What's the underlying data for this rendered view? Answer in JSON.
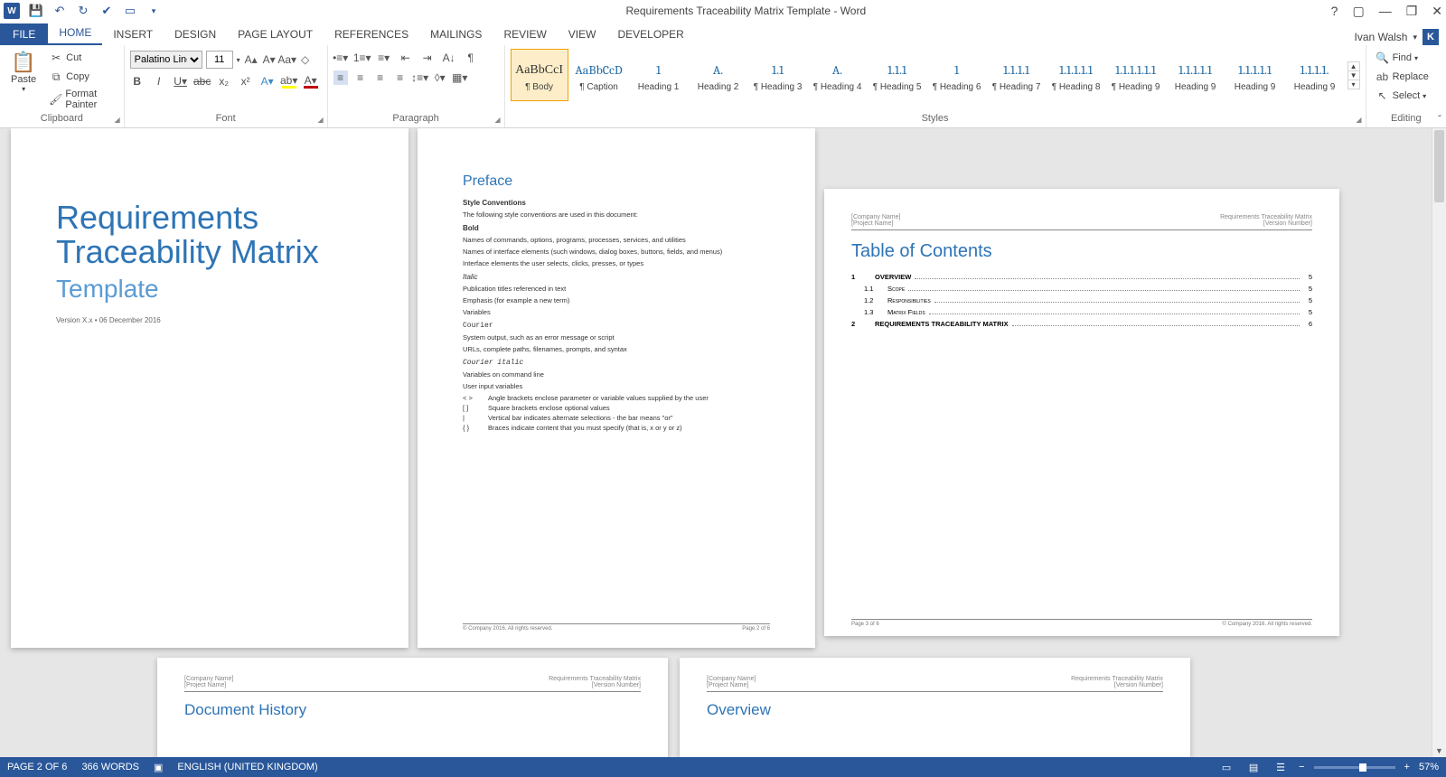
{
  "title": "Requirements Traceability Matrix Template - Word",
  "user": "Ivan Walsh",
  "tabs": {
    "file": "FILE",
    "home": "HOME",
    "insert": "INSERT",
    "design": "DESIGN",
    "page_layout": "PAGE LAYOUT",
    "references": "REFERENCES",
    "mailings": "MAILINGS",
    "review": "REVIEW",
    "view": "VIEW",
    "developer": "DEVELOPER"
  },
  "clipboard": {
    "paste": "Paste",
    "cut": "Cut",
    "copy": "Copy",
    "format_painter": "Format Painter",
    "label": "Clipboard"
  },
  "font": {
    "name": "Palatino Linoty",
    "size": "11",
    "label": "Font"
  },
  "paragraph": {
    "label": "Paragraph"
  },
  "styles": {
    "label": "Styles",
    "items": [
      {
        "preview": "AaBbCcI",
        "name": "¶ Body",
        "cls": "body"
      },
      {
        "preview": "AaBbCcD",
        "name": "¶ Caption",
        "cls": ""
      },
      {
        "preview": "1",
        "name": "Heading 1",
        "cls": ""
      },
      {
        "preview": "A.",
        "name": "Heading 2",
        "cls": ""
      },
      {
        "preview": "1.1",
        "name": "¶ Heading 3",
        "cls": ""
      },
      {
        "preview": "A.",
        "name": "¶ Heading 4",
        "cls": ""
      },
      {
        "preview": "1.1.1",
        "name": "¶ Heading 5",
        "cls": ""
      },
      {
        "preview": "1",
        "name": "¶ Heading 6",
        "cls": ""
      },
      {
        "preview": "1.1.1.1",
        "name": "¶ Heading 7",
        "cls": ""
      },
      {
        "preview": "1.1.1.1.1",
        "name": "¶ Heading 8",
        "cls": ""
      },
      {
        "preview": "1.1.1.1.1.1",
        "name": "¶ Heading 9",
        "cls": ""
      },
      {
        "preview": "1.1.1.1.1",
        "name": "Heading 9",
        "cls": ""
      },
      {
        "preview": "1.1.1.1.1",
        "name": "Heading 9",
        "cls": ""
      },
      {
        "preview": "1.1.1.1.",
        "name": "Heading 9",
        "cls": ""
      }
    ]
  },
  "editing": {
    "find": "Find",
    "replace": "Replace",
    "select": "Select",
    "label": "Editing"
  },
  "statusbar": {
    "page": "PAGE 2 OF 6",
    "words": "366 WORDS",
    "lang": "ENGLISH (UNITED KINGDOM)",
    "zoom": "57%"
  },
  "doc": {
    "page1": {
      "title_line1": "Requirements",
      "title_line2": "Traceability Matrix",
      "subtitle": "Template",
      "version": "Version X.x • 06 December 2016"
    },
    "page2": {
      "title": "Preface",
      "h_style": "Style Conventions",
      "intro": "The following style conventions are used in this document:",
      "bold": "Bold",
      "bold1": "Names of commands, options, programs, processes, services, and utilities",
      "bold2": "Names of interface elements (such windows, dialog boxes, buttons, fields, and menus)",
      "bold3": "Interface elements the user selects, clicks, presses, or types",
      "italic": "Italic",
      "italic1": "Publication titles referenced in text",
      "italic2": "Emphasis (for example a new term)",
      "italic3": "Variables",
      "courier": "Courier",
      "courier1": "System output, such as an error message or script",
      "courier2": "URLs, complete paths, filenames, prompts, and syntax",
      "courieri": "Courier italic",
      "courieri1": "Variables on command line",
      "courieri2": "User input variables",
      "sym1": "< >",
      "sym1t": "Angle brackets enclose parameter or variable values supplied by the user",
      "sym2": "[ ]",
      "sym2t": "Square brackets enclose optional values",
      "sym3": "|",
      "sym3t": "Vertical bar indicates alternate selections - the bar means \"or\"",
      "sym4": "{ }",
      "sym4t": "Braces indicate content that you must specify (that is, x or y or z)",
      "footer_l": "© Company 2016. All rights reserved.",
      "footer_r": "Page 2 of 6"
    },
    "page3": {
      "hdr_l1": "[Company Name]",
      "hdr_l2": "[Project Name]",
      "hdr_r1": "Requirements Traceability Matrix",
      "hdr_r2": "[Version Number]",
      "title": "Table of Contents",
      "toc": [
        {
          "num": "1",
          "txt": "OVERVIEW",
          "pg": "5",
          "sub": false,
          "bold": true,
          "sc": false
        },
        {
          "num": "1.1",
          "txt": "Scope",
          "pg": "5",
          "sub": true,
          "bold": false,
          "sc": true
        },
        {
          "num": "1.2",
          "txt": "Responsibilities",
          "pg": "5",
          "sub": true,
          "bold": false,
          "sc": true
        },
        {
          "num": "1.3",
          "txt": "Matrix Fields",
          "pg": "5",
          "sub": true,
          "bold": false,
          "sc": true
        },
        {
          "num": "2",
          "txt": "REQUIREMENTS TRACEABILITY MATRIX",
          "pg": "6",
          "sub": false,
          "bold": true,
          "sc": false
        }
      ],
      "footer_l": "Page 3 of 6",
      "footer_r": "© Company 2016. All rights reserved."
    },
    "page4": {
      "hdr_l1": "[Company Name]",
      "hdr_l2": "[Project Name]",
      "hdr_r1": "Requirements Traceability Matrix",
      "hdr_r2": "[Version Number]",
      "title": "Document History"
    },
    "page5": {
      "hdr_l1": "[Company Name]",
      "hdr_l2": "[Project Name]",
      "hdr_r1": "Requirements Traceability Matrix",
      "hdr_r2": "[Version Number]",
      "title": "Overview"
    }
  }
}
